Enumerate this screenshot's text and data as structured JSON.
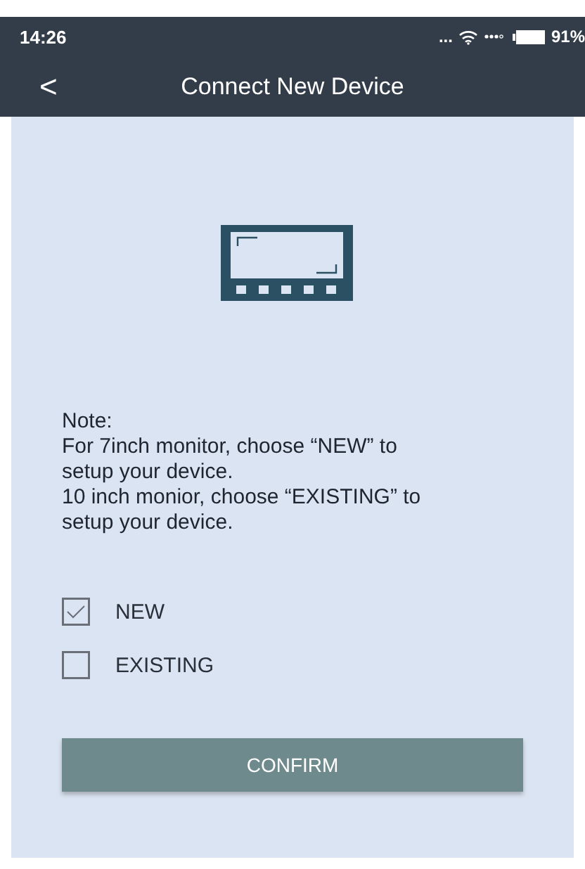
{
  "status_bar": {
    "time": "14:26",
    "dots": "...",
    "battery": "91%"
  },
  "nav": {
    "back": "<",
    "title": "Connect New Device"
  },
  "note": [
    "Note:",
    "For 7inch monitor, choose “NEW” to setup your device.",
    "10 inch monior, choose “EXISTING” to setup your device."
  ],
  "options": [
    {
      "label": "NEW",
      "checked": true
    },
    {
      "label": "EXISTING",
      "checked": false
    }
  ],
  "confirm": "CONFIRM"
}
